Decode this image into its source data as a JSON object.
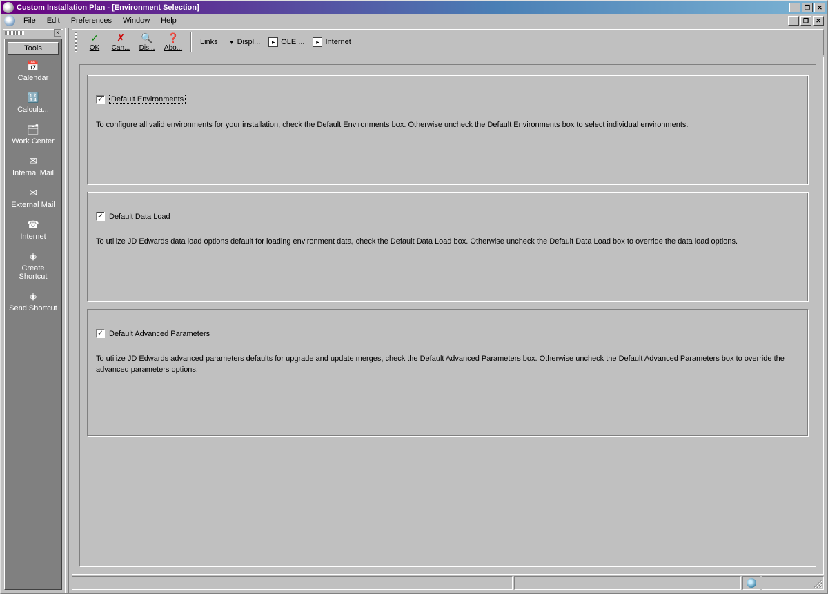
{
  "window": {
    "title": "Custom Installation Plan - [Environment Selection]",
    "min_glyph": "_",
    "max_glyph": "❐",
    "close_glyph": "✕"
  },
  "menubar": {
    "items": [
      "File",
      "Edit",
      "Preferences",
      "Window",
      "Help"
    ]
  },
  "mdi": {
    "min_glyph": "_",
    "restore_glyph": "❐",
    "close_glyph": "✕"
  },
  "toolsPanel": {
    "header": "Tools",
    "items": [
      {
        "label": "Calendar",
        "icon": "📅"
      },
      {
        "label": "Calcula...",
        "icon": "🔢"
      },
      {
        "label": "Work Center",
        "icon": "🗂"
      },
      {
        "label": "Internal Mail",
        "icon": "✉"
      },
      {
        "label": "External Mail",
        "icon": "✉"
      },
      {
        "label": "Internet",
        "icon": "☎"
      },
      {
        "label": "Create Shortcut",
        "icon": "◈"
      },
      {
        "label": "Send Shortcut",
        "icon": "◈"
      }
    ],
    "close_glyph": "×"
  },
  "toolbar": {
    "buttons": [
      {
        "label": "OK",
        "icon": "✓",
        "color": "#008000"
      },
      {
        "label": "Can...",
        "icon": "✗",
        "color": "#cc0000"
      },
      {
        "label": "Dis...",
        "icon": "🔍",
        "color": "#0066cc"
      },
      {
        "label": "Abo...",
        "icon": "❓",
        "color": "#cc9900"
      }
    ],
    "links_label": "Links",
    "drop_glyph": "▼",
    "links": [
      {
        "label": "Displ...",
        "has_dropdown": true
      },
      {
        "label": "OLE ...",
        "has_dropdown": false
      },
      {
        "label": "Internet",
        "has_dropdown": false
      }
    ],
    "link_icon_glyph": "▸"
  },
  "options": [
    {
      "checkbox_label": "Default Environments",
      "checked": true,
      "focused": true,
      "description": "To configure all valid environments for your installation, check the Default Environments box.  Otherwise uncheck the Default Environments box to select individual environments."
    },
    {
      "checkbox_label": "Default Data Load",
      "checked": true,
      "focused": false,
      "description": "To utilize JD Edwards data load options default for loading environment data, check the Default Data Load box.  Otherwise uncheck the Default Data Load box to override the data load options."
    },
    {
      "checkbox_label": "Default Advanced Parameters",
      "checked": true,
      "focused": false,
      "description": "To utilize JD Edwards advanced parameters defaults for upgrade and update merges, check the Default Advanced Parameters box.  Otherwise uncheck the Default Advanced Parameters box to override the advanced parameters options."
    }
  ],
  "check_glyph": "✓"
}
